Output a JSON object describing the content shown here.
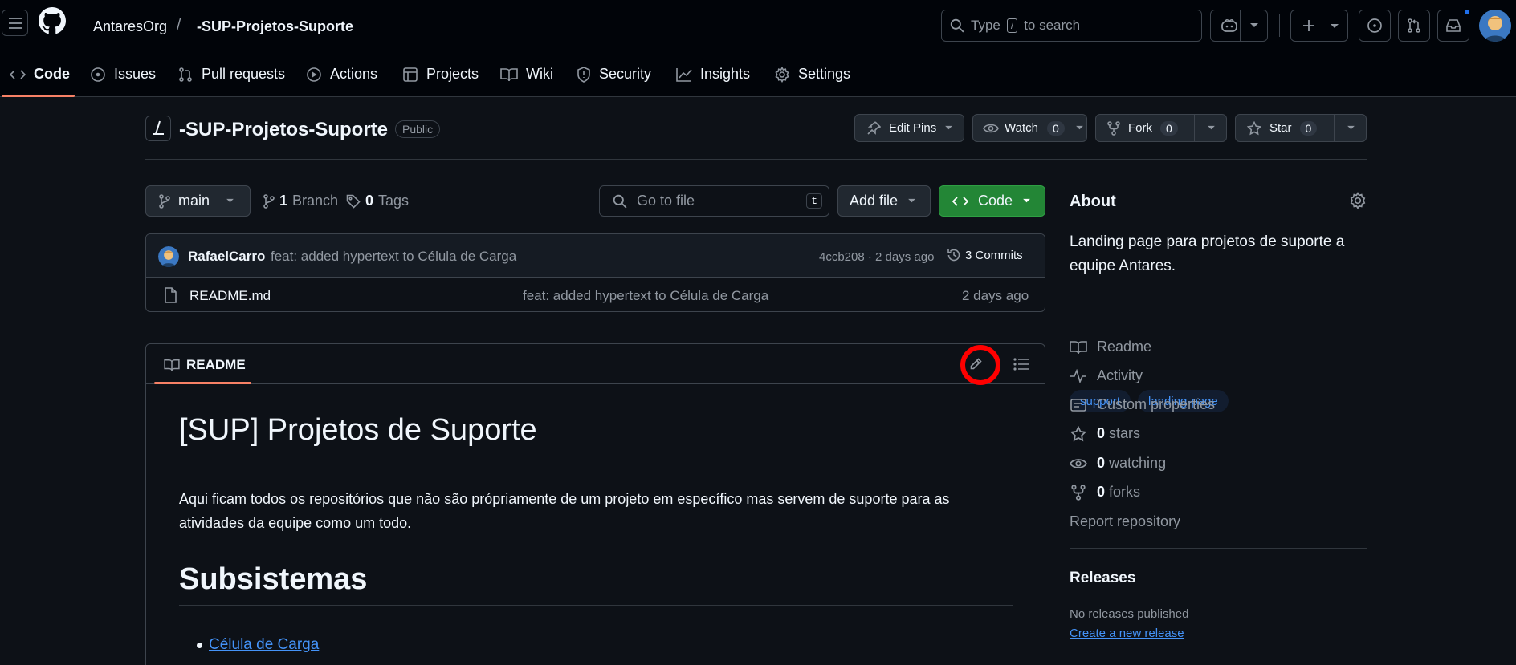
{
  "header": {
    "owner": "AntaresOrg",
    "separator": "/",
    "repo": "-SUP-Projetos-Suporte",
    "search_prefix": "Type",
    "search_key": "/",
    "search_suffix": "to search"
  },
  "nav": {
    "tabs": [
      {
        "label": "Code",
        "icon": "code-icon"
      },
      {
        "label": "Issues",
        "icon": "issue-icon"
      },
      {
        "label": "Pull requests",
        "icon": "pull-request-icon"
      },
      {
        "label": "Actions",
        "icon": "play-icon"
      },
      {
        "label": "Projects",
        "icon": "table-icon"
      },
      {
        "label": "Wiki",
        "icon": "book-icon"
      },
      {
        "label": "Security",
        "icon": "shield-icon"
      },
      {
        "label": "Insights",
        "icon": "graph-icon"
      },
      {
        "label": "Settings",
        "icon": "gear-icon"
      }
    ]
  },
  "repo": {
    "title": "-SUP-Projetos-Suporte",
    "visibility": "Public",
    "edit_pins": "Edit Pins",
    "watch": "Watch",
    "watch_count": "0",
    "fork": "Fork",
    "fork_count": "0",
    "star": "Star",
    "star_count": "0"
  },
  "toolbar": {
    "branch": "main",
    "branch_count": "1",
    "branch_label": "Branch",
    "tag_count": "0",
    "tag_label": "Tags",
    "goto_placeholder": "Go to file",
    "goto_key": "t",
    "add_file": "Add file",
    "code": "Code"
  },
  "commit": {
    "author": "RafaelCarro",
    "message": "feat: added hypertext to Célula de Carga",
    "meta": "4ccb208 · 2 days ago",
    "commits": "3 Commits"
  },
  "files": [
    {
      "name": "README.md",
      "message": "feat: added hypertext to Célula de Carga",
      "age": "2 days ago"
    }
  ],
  "readme": {
    "tab": "README",
    "h1": "[SUP] Projetos de Suporte",
    "p": "Aqui ficam todos os repositórios que não são própriamente de um projeto em específico mas servem de suporte para as atividades da equipe como um todo.",
    "h2": "Subsistemas",
    "items": [
      "Célula de Carga"
    ]
  },
  "about": {
    "title": "About",
    "description": "Landing page para projetos de suporte a equipe Antares.",
    "topics": [
      "support",
      "landing-page"
    ],
    "readme": "Readme",
    "activity": "Activity",
    "custom_properties": "Custom properties",
    "stars_count": "0",
    "stars_label": "stars",
    "watching_count": "0",
    "watching_label": "watching",
    "forks_count": "0",
    "forks_label": "forks",
    "report": "Report repository"
  },
  "releases": {
    "title": "Releases",
    "none": "No releases published",
    "create": "Create a new release"
  },
  "colors": {
    "accent": "#4493f8",
    "green": "#238636",
    "highlight_ring": "#ff0000",
    "tab_underline": "#f78166"
  }
}
